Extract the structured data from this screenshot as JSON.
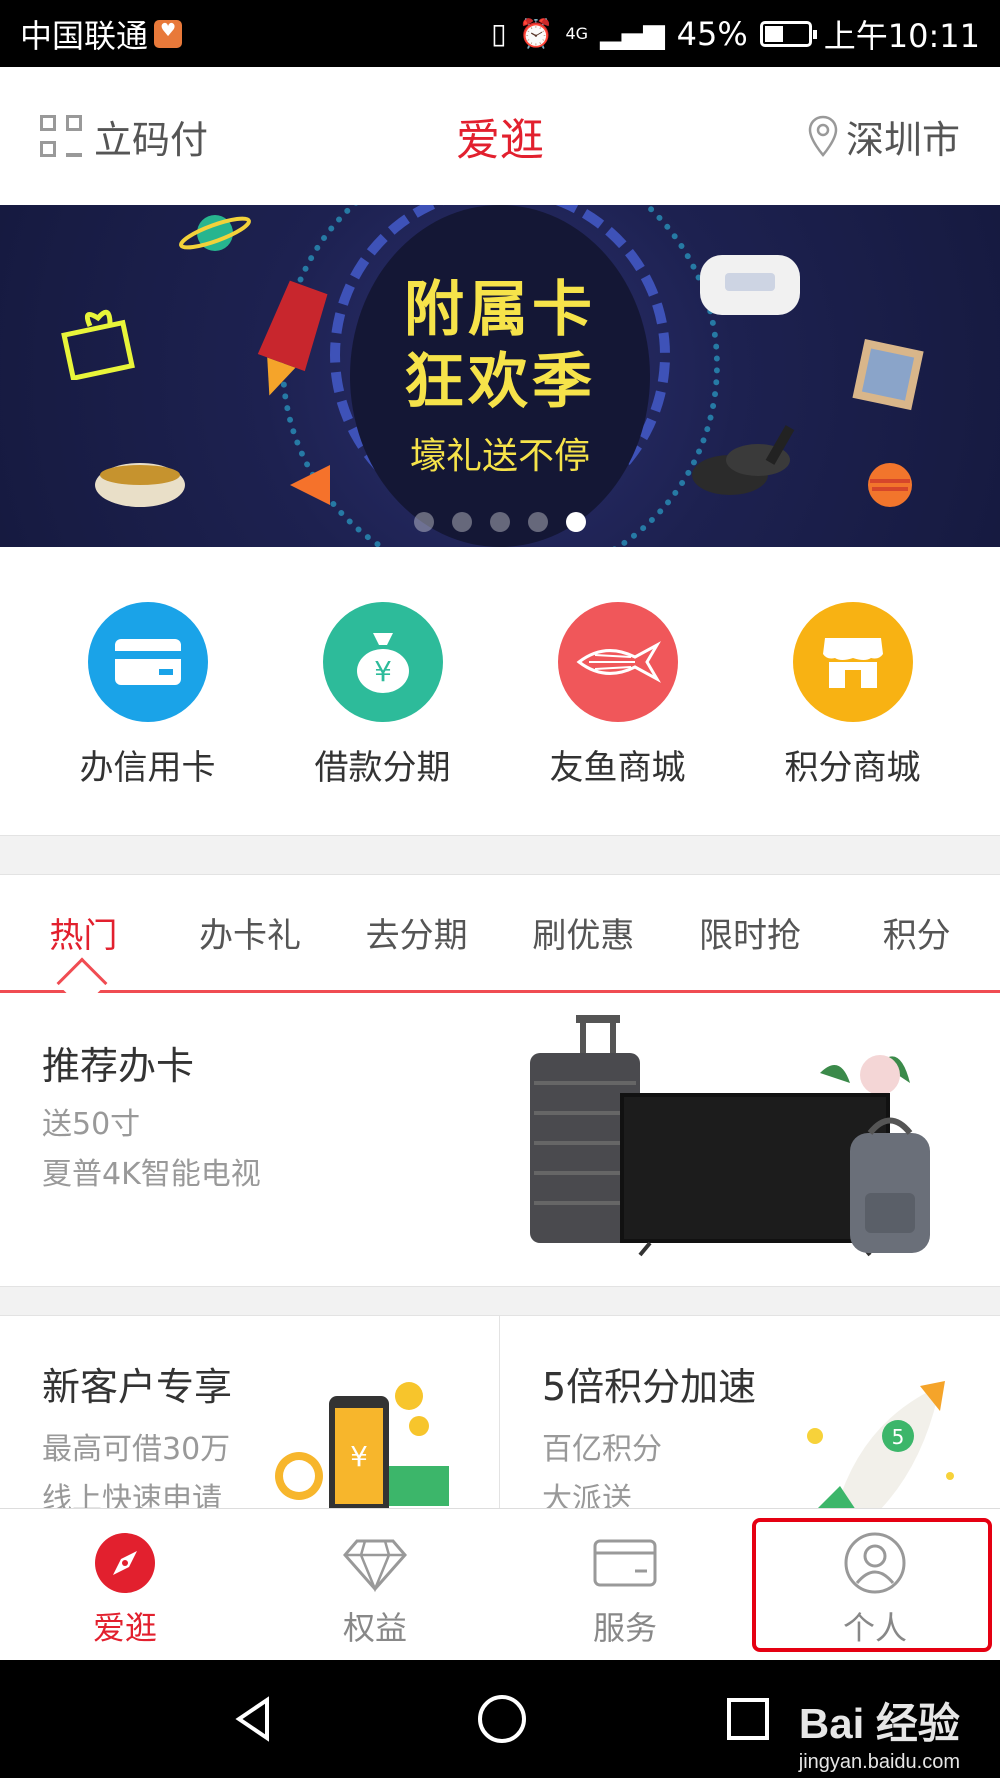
{
  "status_bar": {
    "carrier": "中国联通",
    "network": "4G",
    "battery": "45%",
    "time": "上午10:11"
  },
  "header": {
    "pay_label": "立码付",
    "title": "爱逛",
    "city": "深圳市"
  },
  "banner": {
    "title_line1": "附属卡",
    "title_line2": "狂欢季",
    "subtitle": "壕礼送不停",
    "slide_count": 5,
    "active_slide": 5
  },
  "quick_entries": [
    {
      "label": "办信用卡",
      "icon": "credit-card-icon",
      "color": "#1aa3e8"
    },
    {
      "label": "借款分期",
      "icon": "money-bag-icon",
      "color": "#2dbb9a"
    },
    {
      "label": "友鱼商城",
      "icon": "fish-icon",
      "color": "#f0575a"
    },
    {
      "label": "积分商城",
      "icon": "store-icon",
      "color": "#f8b213"
    }
  ],
  "tabs": [
    {
      "label": "热门",
      "active": true
    },
    {
      "label": "办卡礼"
    },
    {
      "label": "去分期"
    },
    {
      "label": "刷优惠"
    },
    {
      "label": "限时抢"
    },
    {
      "label": "积分"
    }
  ],
  "recommend": {
    "title": "推荐办卡",
    "line1": "送50寸",
    "line2": "夏普4K智能电视"
  },
  "promos": [
    {
      "title": "新客户专享",
      "line1": "最高可借30万",
      "line2": "线上快速申请"
    },
    {
      "title": "5倍积分加速",
      "line1": "百亿积分",
      "line2": "大派送",
      "badge": "5"
    }
  ],
  "tab_bar": [
    {
      "label": "爱逛",
      "icon": "compass-icon",
      "active": true
    },
    {
      "label": "权益",
      "icon": "diamond-icon"
    },
    {
      "label": "服务",
      "icon": "card-icon"
    },
    {
      "label": "个人",
      "icon": "person-icon"
    }
  ],
  "watermark": {
    "main": "Bai 经验",
    "sub": "jingyan.baidu.com"
  },
  "colors": {
    "accent": "#e2202e",
    "highlight": "#e50012"
  }
}
